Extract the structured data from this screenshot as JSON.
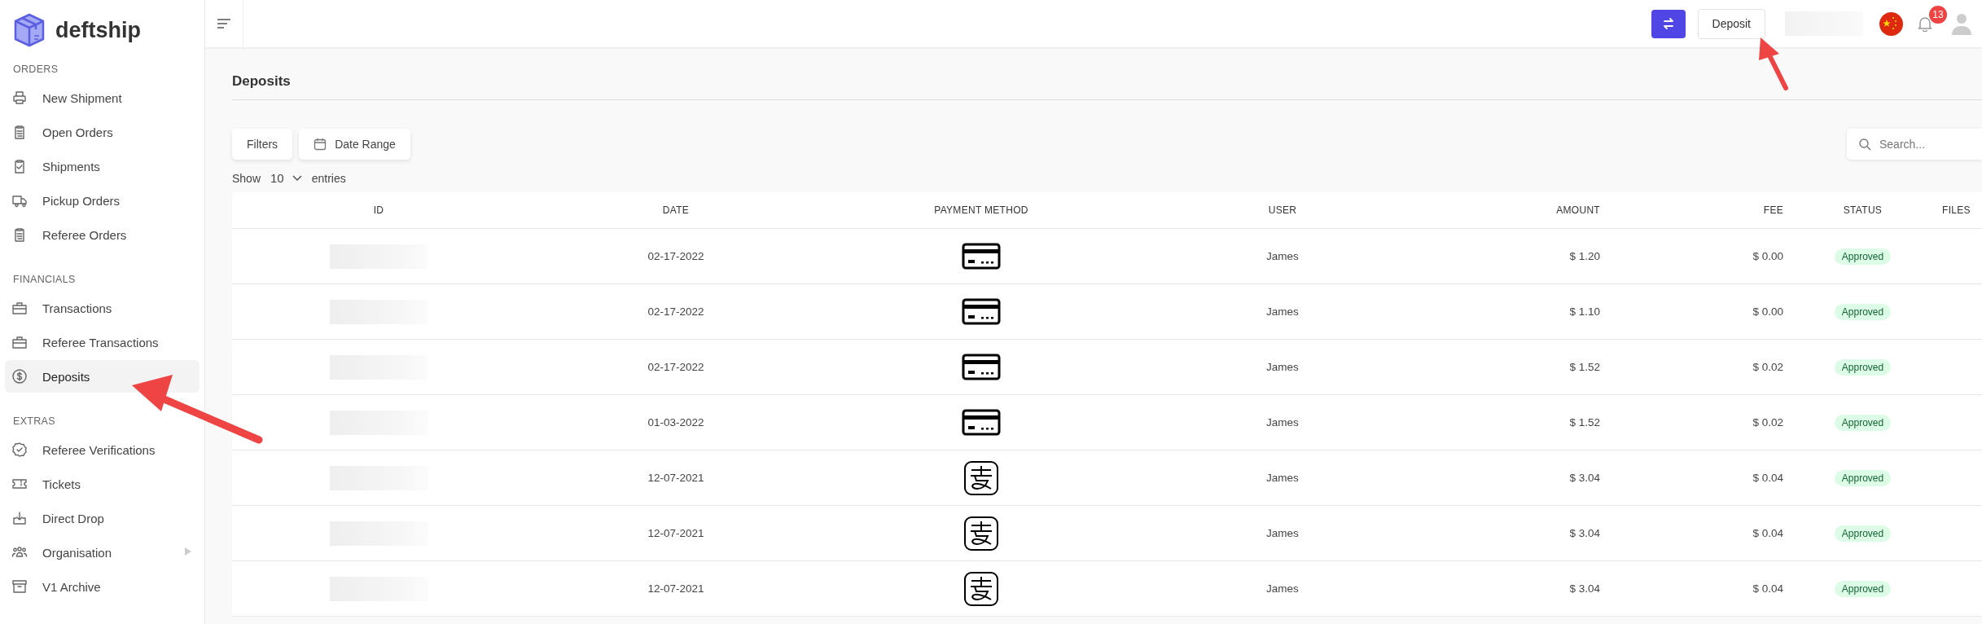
{
  "sidebar": {
    "logo": "deftship",
    "sections": [
      {
        "title": "ORDERS",
        "items": [
          {
            "label": "New Shipment",
            "selected": false,
            "has_submenu": false
          },
          {
            "label": "Open Orders",
            "selected": false,
            "has_submenu": false
          },
          {
            "label": "Shipments",
            "selected": false,
            "has_submenu": false
          },
          {
            "label": "Pickup Orders",
            "selected": false,
            "has_submenu": false
          },
          {
            "label": "Referee Orders",
            "selected": false,
            "has_submenu": false
          }
        ]
      },
      {
        "title": "FINANCIALS",
        "items": [
          {
            "label": "Transactions",
            "selected": false,
            "has_submenu": false
          },
          {
            "label": "Referee Transactions",
            "selected": false,
            "has_submenu": false
          },
          {
            "label": "Deposits",
            "selected": true,
            "has_submenu": false
          }
        ]
      },
      {
        "title": "EXTRAS",
        "items": [
          {
            "label": "Referee Verifications",
            "selected": false,
            "has_submenu": false
          },
          {
            "label": "Tickets",
            "selected": false,
            "has_submenu": false
          },
          {
            "label": "Direct Drop",
            "selected": false,
            "has_submenu": false
          },
          {
            "label": "Organisation",
            "selected": false,
            "has_submenu": true
          },
          {
            "label": "V1 Archive",
            "selected": false,
            "has_submenu": false
          }
        ]
      }
    ]
  },
  "header": {
    "deposit_button": "Deposit",
    "notification_count": "13"
  },
  "page": {
    "title": "Deposits",
    "filters_button": "Filters",
    "date_range_button": "Date Range",
    "search": {
      "placeholder": "Search..."
    },
    "show_label": "Show",
    "entries_value": "10",
    "entries_label": "entries"
  },
  "table": {
    "columns": [
      "ID",
      "DATE",
      "PAYMENT METHOD",
      "USER",
      "AMOUNT",
      "FEE",
      "STATUS",
      "FILES"
    ],
    "rows": [
      {
        "date": "02-17-2022",
        "payment_method": {
          "kind": "card"
        },
        "user": "James",
        "amount": "$ 1.20",
        "fee": "$ 0.00",
        "status": "Approved"
      },
      {
        "date": "02-17-2022",
        "payment_method": {
          "kind": "card"
        },
        "user": "James",
        "amount": "$ 1.10",
        "fee": "$ 0.00",
        "status": "Approved"
      },
      {
        "date": "02-17-2022",
        "payment_method": {
          "kind": "card"
        },
        "user": "James",
        "amount": "$ 1.52",
        "fee": "$ 0.02",
        "status": "Approved"
      },
      {
        "date": "01-03-2022",
        "payment_method": {
          "kind": "card"
        },
        "user": "James",
        "amount": "$ 1.52",
        "fee": "$ 0.02",
        "status": "Approved"
      },
      {
        "date": "12-07-2021",
        "payment_method": {
          "kind": "alipay"
        },
        "user": "James",
        "amount": "$ 3.04",
        "fee": "$ 0.04",
        "status": "Approved"
      },
      {
        "date": "12-07-2021",
        "payment_method": {
          "kind": "alipay"
        },
        "user": "James",
        "amount": "$ 3.04",
        "fee": "$ 0.04",
        "status": "Approved"
      },
      {
        "date": "12-07-2021",
        "payment_method": {
          "kind": "alipay"
        },
        "user": "James",
        "amount": "$ 3.04",
        "fee": "$ 0.04",
        "status": "Approved"
      }
    ]
  }
}
